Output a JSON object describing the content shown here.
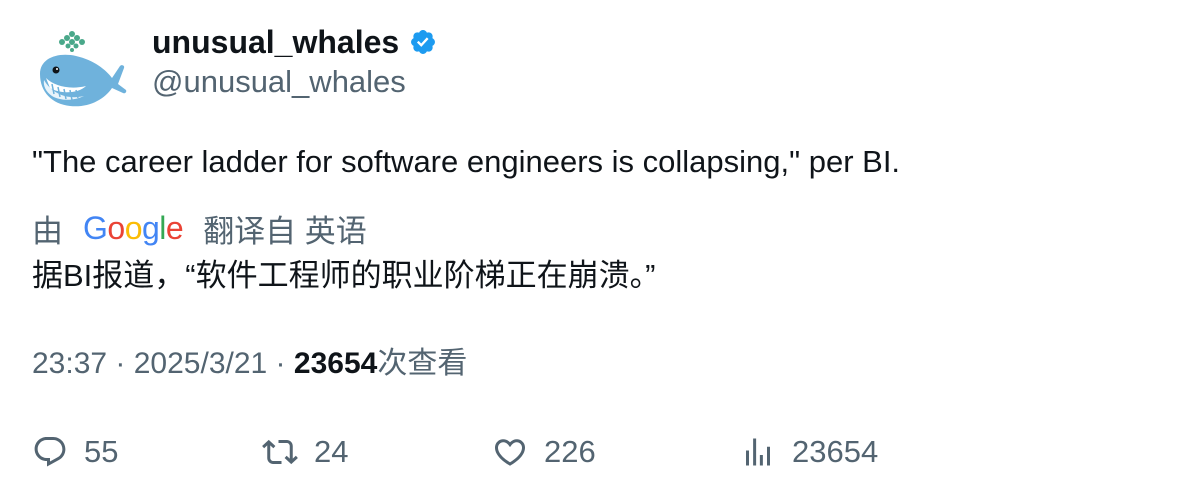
{
  "author": {
    "display_name": "unusual_whales",
    "handle": "@unusual_whales",
    "verified_color": "#1d9bf0"
  },
  "tweet": {
    "text": "\"The career ladder for software engineers is collapsing,\" per BI.",
    "translation": {
      "prefix": "由",
      "provider_logo": "Google",
      "suffix": "翻译自 英语",
      "text": "据BI报道，“软件工程师的职业阶梯正在崩溃。”"
    }
  },
  "meta": {
    "time": "23:37",
    "separator1": " · ",
    "date": "2025/3/21",
    "separator2": " · ",
    "views_count": "23654",
    "views_label": "次查看"
  },
  "actions": {
    "reply": {
      "icon": "reply-icon",
      "count": "55"
    },
    "retweet": {
      "icon": "retweet-icon",
      "count": "24"
    },
    "like": {
      "icon": "heart-icon",
      "count": "226"
    },
    "views": {
      "icon": "bar-chart-icon",
      "count": "23654"
    }
  },
  "colors": {
    "text_primary": "#0f1419",
    "text_secondary": "#536471",
    "google_blue": "#4285f4",
    "google_red": "#ea4335",
    "google_yellow": "#fbbc05",
    "google_green": "#34a853"
  }
}
